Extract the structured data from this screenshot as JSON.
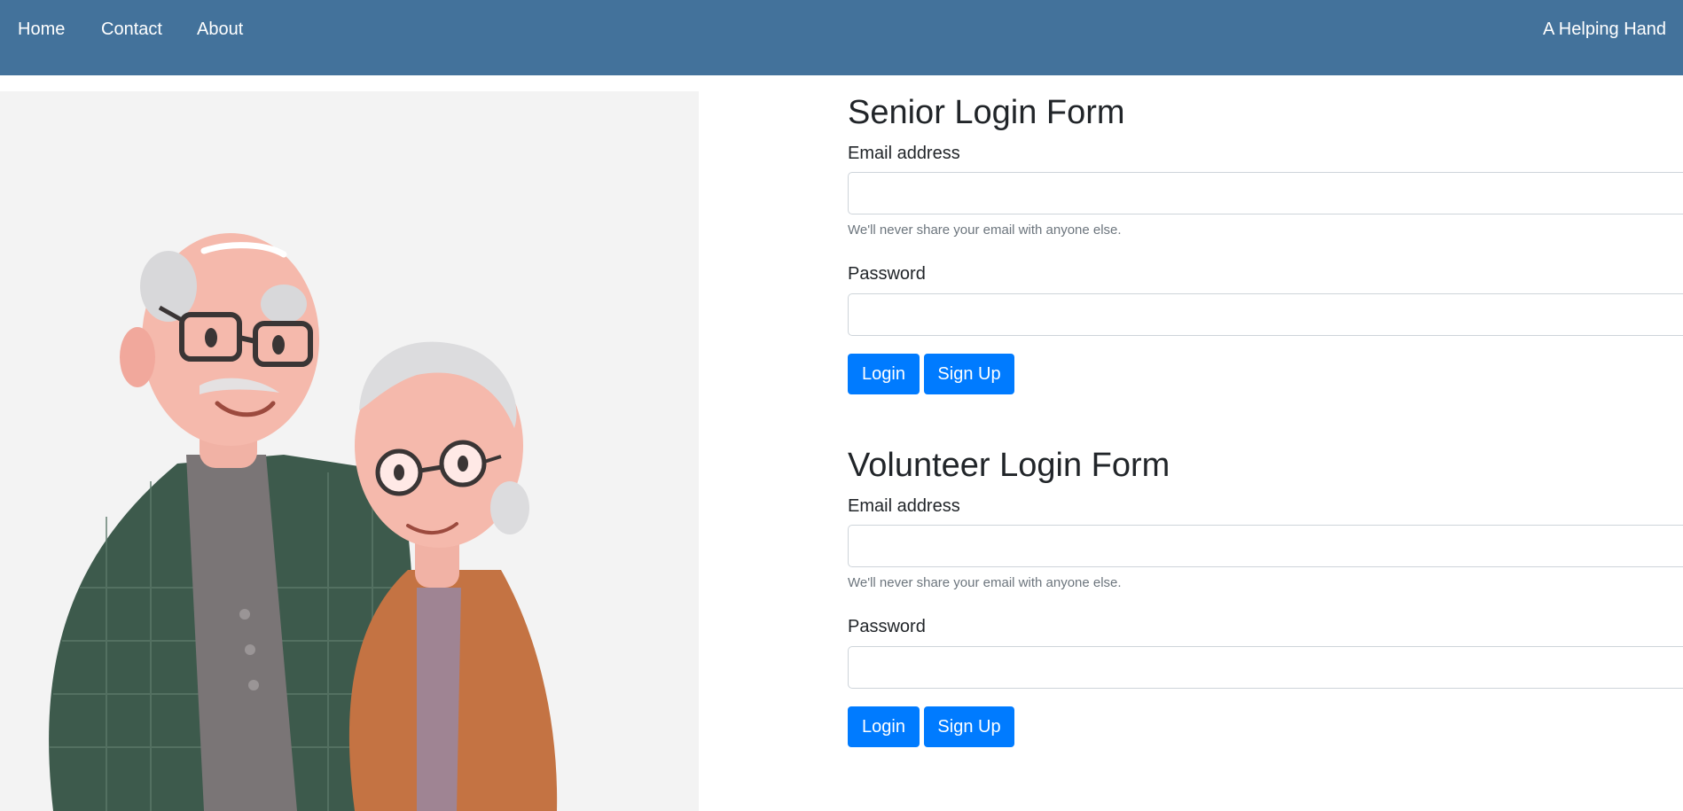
{
  "nav": {
    "links": [
      "Home",
      "Contact",
      "About"
    ],
    "brand": "A Helping Hand"
  },
  "colors": {
    "navbar": "#43729b",
    "button": "#007bff",
    "illustration_bg": "#f3f3f3"
  },
  "illustration": {
    "icon": "elderly-couple-illustration"
  },
  "senior_form": {
    "title": "Senior Login Form",
    "email_label": "Email address",
    "email_value": "",
    "email_help": "We'll never share your email with anyone else.",
    "password_label": "Password",
    "password_value": "",
    "login_label": "Login",
    "signup_label": "Sign Up"
  },
  "volunteer_form": {
    "title": "Volunteer Login Form",
    "email_label": "Email address",
    "email_value": "",
    "email_help": "We'll never share your email with anyone else.",
    "password_label": "Password",
    "password_value": "",
    "login_label": "Login",
    "signup_label": "Sign Up"
  }
}
